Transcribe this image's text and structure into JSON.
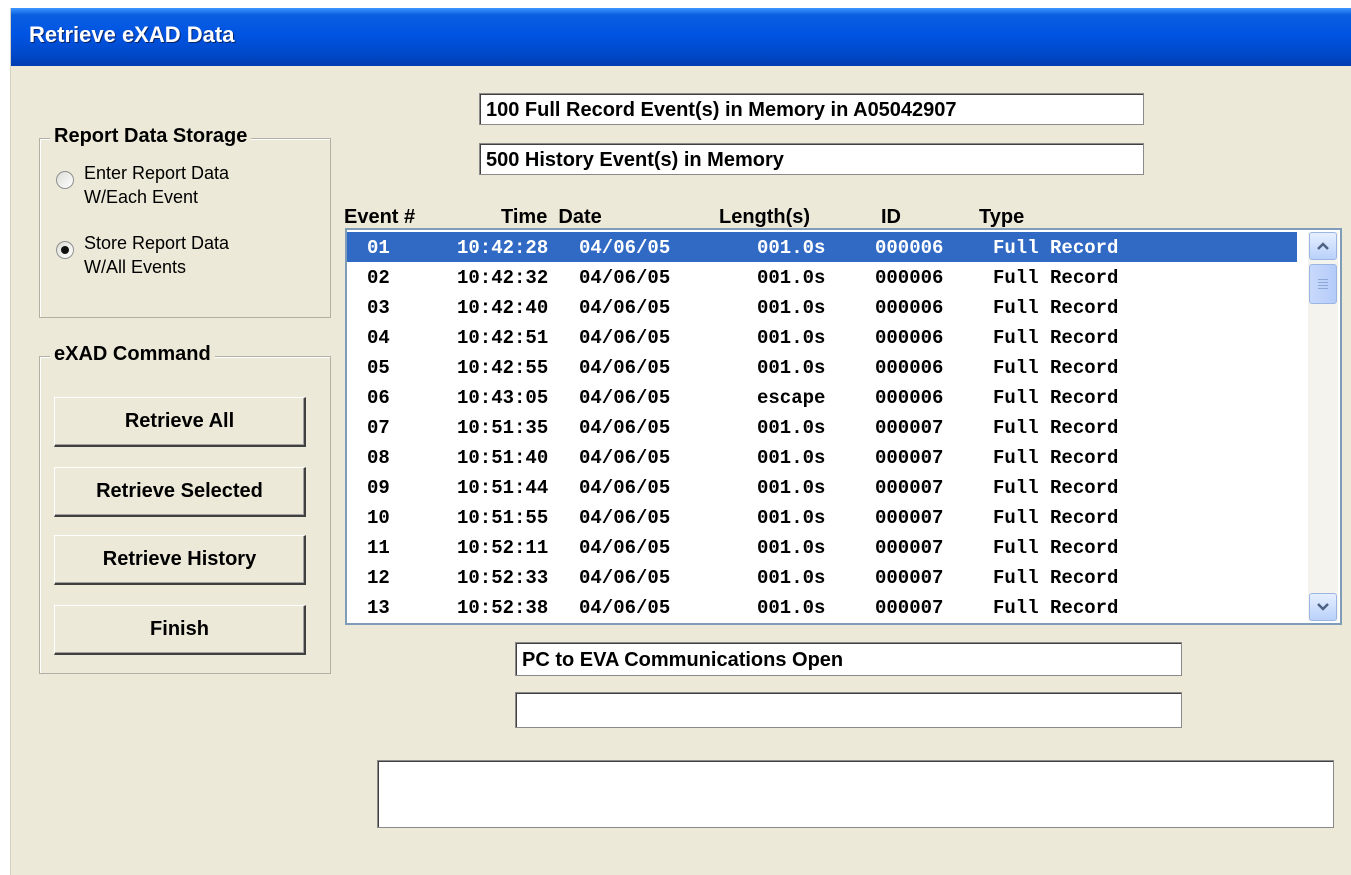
{
  "window": {
    "title": "Retrieve eXAD Data"
  },
  "status": {
    "full_record_events": "100 Full Record Event(s) in Memory in A05042907",
    "history_events": "500 History Event(s) in Memory",
    "comm_status": "PC to EVA Communications Open",
    "comm_status_2": "",
    "message": ""
  },
  "report_storage": {
    "legend": "Report Data Storage",
    "option1": "Enter Report Data W/Each Event",
    "option2": "Store Report Data W/All Events",
    "selected": "option2"
  },
  "commands": {
    "legend": "eXAD Command",
    "retrieve_all": "Retrieve All",
    "retrieve_selected": "Retrieve Selected",
    "retrieve_history": "Retrieve History",
    "finish": "Finish"
  },
  "columns": {
    "event": "Event #",
    "time_date": "Time  Date",
    "length": "Length(s)",
    "id": "ID",
    "type": "Type"
  },
  "events": [
    {
      "num": "01",
      "time": "10:42:28",
      "date": "04/06/05",
      "length": "001.0s",
      "id": "000006",
      "type": "Full Record"
    },
    {
      "num": "02",
      "time": "10:42:32",
      "date": "04/06/05",
      "length": "001.0s",
      "id": "000006",
      "type": "Full Record"
    },
    {
      "num": "03",
      "time": "10:42:40",
      "date": "04/06/05",
      "length": "001.0s",
      "id": "000006",
      "type": "Full Record"
    },
    {
      "num": "04",
      "time": "10:42:51",
      "date": "04/06/05",
      "length": "001.0s",
      "id": "000006",
      "type": "Full Record"
    },
    {
      "num": "05",
      "time": "10:42:55",
      "date": "04/06/05",
      "length": "001.0s",
      "id": "000006",
      "type": "Full Record"
    },
    {
      "num": "06",
      "time": "10:43:05",
      "date": "04/06/05",
      "length": "escape",
      "id": "000006",
      "type": "Full Record"
    },
    {
      "num": "07",
      "time": "10:51:35",
      "date": "04/06/05",
      "length": "001.0s",
      "id": "000007",
      "type": "Full Record"
    },
    {
      "num": "08",
      "time": "10:51:40",
      "date": "04/06/05",
      "length": "001.0s",
      "id": "000007",
      "type": "Full Record"
    },
    {
      "num": "09",
      "time": "10:51:44",
      "date": "04/06/05",
      "length": "001.0s",
      "id": "000007",
      "type": "Full Record"
    },
    {
      "num": "10",
      "time": "10:51:55",
      "date": "04/06/05",
      "length": "001.0s",
      "id": "000007",
      "type": "Full Record"
    },
    {
      "num": "11",
      "time": "10:52:11",
      "date": "04/06/05",
      "length": "001.0s",
      "id": "000007",
      "type": "Full Record"
    },
    {
      "num": "12",
      "time": "10:52:33",
      "date": "04/06/05",
      "length": "001.0s",
      "id": "000007",
      "type": "Full Record"
    },
    {
      "num": "13",
      "time": "10:52:38",
      "date": "04/06/05",
      "length": "001.0s",
      "id": "000007",
      "type": "Full Record"
    }
  ],
  "selected_row": 0,
  "icons": {
    "scroll_up": "chevron-up-icon",
    "scroll_down": "chevron-down-icon"
  }
}
